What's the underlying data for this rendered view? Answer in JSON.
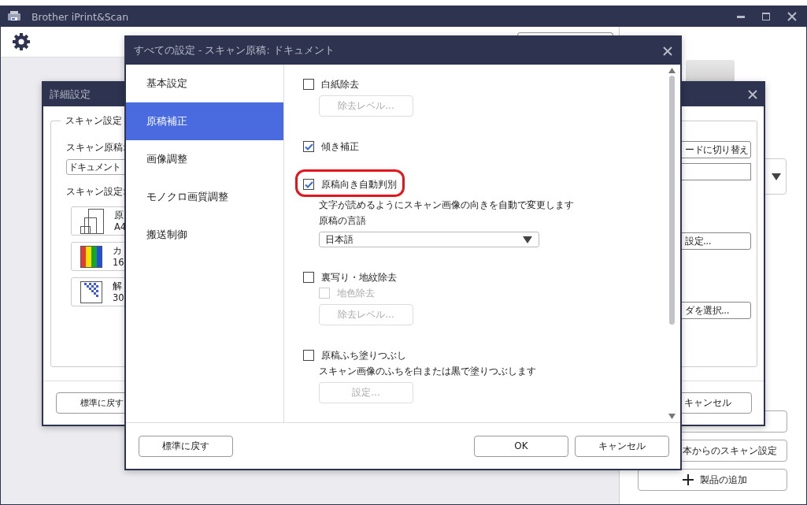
{
  "main_window": {
    "title": "Brother iPrint&Scan",
    "side_buttons": [
      {
        "kind": "blank"
      },
      {
        "kind": "text",
        "label": "本からのスキャン設定"
      },
      {
        "kind": "add",
        "label": "製品の追加"
      }
    ]
  },
  "details_window": {
    "title": "詳細設定",
    "group_title": "スキャン設定",
    "source_label": "スキャン原稿:",
    "source_value": "ドキュメント",
    "settings_label": "スキャン設定:",
    "tiles": [
      {
        "kind": "size",
        "line1": "原",
        "line2": "A4"
      },
      {
        "kind": "color",
        "line1": "カ",
        "line2": "16"
      },
      {
        "kind": "resolution",
        "line1": "解",
        "line2": "30"
      }
    ],
    "side_controls": [
      {
        "kind": "button",
        "label": "ードに切り替え"
      },
      {
        "kind": "field"
      },
      {
        "kind": "button",
        "label": "設定..."
      },
      {
        "kind": "button",
        "label": "ダを選択..."
      }
    ],
    "footer_buttons": [
      "標準に戻す",
      "キャンセル"
    ]
  },
  "settings_dialog": {
    "title": "すべての設定 - スキャン原稿: ドキュメント",
    "nav": [
      {
        "label": "基本設定",
        "selected": false
      },
      {
        "label": "原稿補正",
        "selected": true
      },
      {
        "label": "画像調整",
        "selected": false
      },
      {
        "label": "モノクロ画質調整",
        "selected": false
      },
      {
        "label": "搬送制御",
        "selected": false
      }
    ],
    "groups": [
      {
        "option": {
          "label": "白紙除去",
          "checked": false,
          "highlighted": false
        },
        "children": [
          {
            "kind": "button",
            "label": "除去レベル...",
            "disabled": true
          }
        ]
      },
      {
        "option": {
          "label": "傾き補正",
          "checked": true,
          "highlighted": false
        }
      },
      {
        "option": {
          "label": "原稿向き自動判別",
          "checked": true,
          "highlighted": true
        },
        "children": [
          {
            "kind": "text",
            "label": "文字が読めるようにスキャン画像の向きを自動で変更します"
          },
          {
            "kind": "text",
            "label": "原稿の言語"
          },
          {
            "kind": "select",
            "label": "日本語"
          }
        ]
      },
      {
        "option": {
          "label": "裏写り・地紋除去",
          "checked": false,
          "highlighted": false
        },
        "children": [
          {
            "kind": "checkbox",
            "label": "地色除去",
            "checked": false,
            "disabled": true
          },
          {
            "kind": "button",
            "label": "除去レベル...",
            "disabled": true
          }
        ]
      },
      {
        "option": {
          "label": "原稿ふち塗りつぶし",
          "checked": false,
          "highlighted": false
        },
        "children": [
          {
            "kind": "text",
            "label": "スキャン画像のふちを白または黒で塗りつぶします"
          },
          {
            "kind": "button",
            "label": "設定...",
            "disabled": true
          }
        ]
      }
    ],
    "footer": {
      "reset": "標準に戻す",
      "ok": "OK",
      "cancel": "キャンセル"
    }
  }
}
